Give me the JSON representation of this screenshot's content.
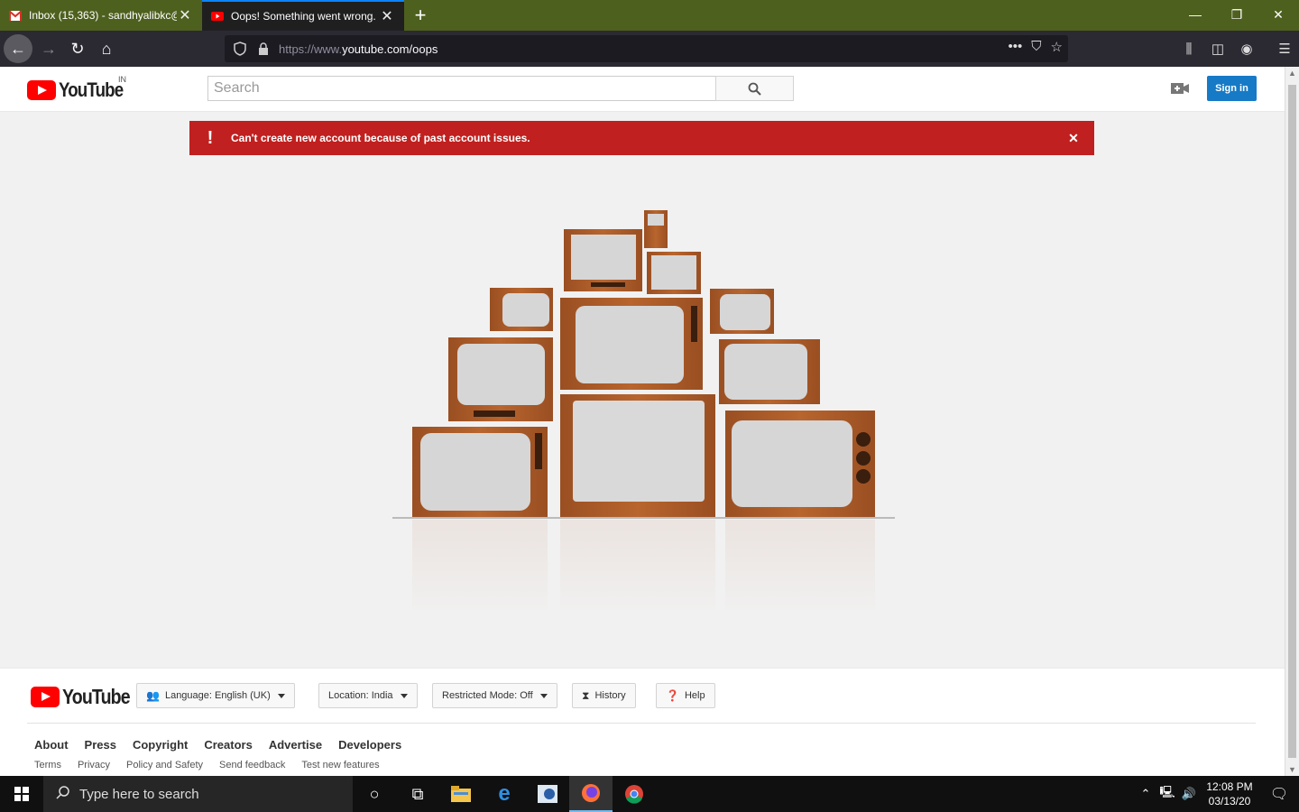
{
  "browser": {
    "tabs": [
      {
        "title": "Inbox (15,363) - sandhyalibkc@",
        "active": false,
        "favicon": "gmail-icon"
      },
      {
        "title": "Oops! Something went wrong.",
        "active": true,
        "favicon": "youtube-icon"
      }
    ],
    "url_prefix": "https://www.",
    "url_main": "youtube.com/oops"
  },
  "header": {
    "logo_text": "YouTube",
    "country_code": "IN",
    "search_placeholder": "Search",
    "signin_label": "Sign in"
  },
  "alert": {
    "message": "Can't create new account because of past account issues.",
    "color": "#c0201f"
  },
  "footer": {
    "logo_text": "YouTube",
    "language_label": "Language: English (UK)",
    "location_label": "Location: India",
    "restricted_label": "Restricted Mode: Off",
    "history_label": "History",
    "help_label": "Help",
    "primary_links": [
      "About",
      "Press",
      "Copyright",
      "Creators",
      "Advertise",
      "Developers"
    ],
    "secondary_links": [
      "Terms",
      "Privacy",
      "Policy and Safety",
      "Send feedback",
      "Test new features"
    ]
  },
  "taskbar": {
    "search_placeholder": "Type here to search",
    "time": "12:08 PM",
    "date": "03/13/20"
  },
  "colors": {
    "brand_red": "#ff0000",
    "signin_blue": "#167ac6",
    "tabbar_green": "#4e601e"
  }
}
